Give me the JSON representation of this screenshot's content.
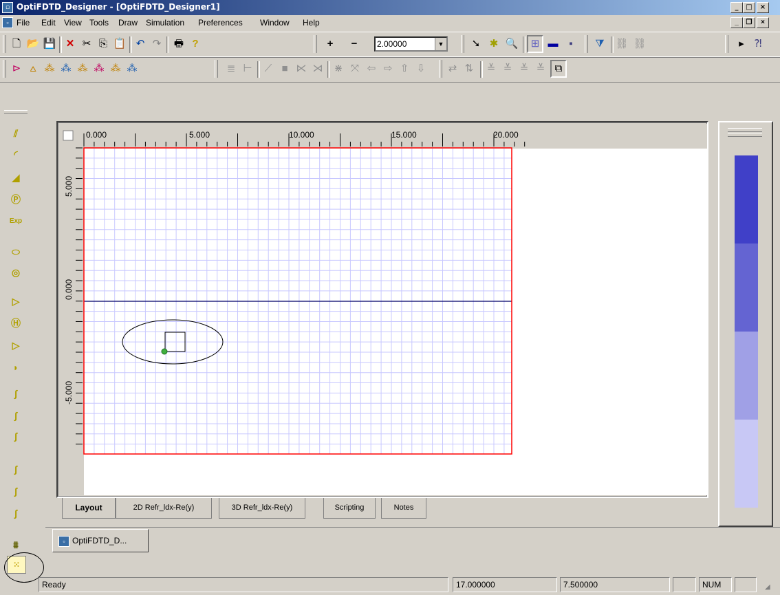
{
  "window": {
    "title": "OptiFDTD_Designer - [OptiFDTD_Designer1]",
    "app_icon": "optifdtd-app-icon"
  },
  "menu": [
    "File",
    "Edit",
    "View",
    "Tools",
    "Draw",
    "Simulation",
    "Preferences",
    "Window",
    "Help"
  ],
  "toolbar": {
    "zoom_value": "2.00000",
    "plus_label": "+",
    "minus_label": "−"
  },
  "ruler": {
    "h_labels": [
      "0.000",
      "5.000",
      "10.000",
      "15.000",
      "20.000"
    ],
    "v_labels": [
      "5.000",
      "0.000",
      "-5.000"
    ]
  },
  "tabs": [
    "Layout",
    "2D Refr_ldx-Re(y)",
    "3D Refr_ldx-Re(y)",
    "Scripting",
    "Notes"
  ],
  "doc_tab": {
    "label": "OptiFDTD_D..."
  },
  "status": {
    "text": "Ready",
    "x": "17.000000",
    "y": "7.500000",
    "num": "NUM"
  },
  "colors": {
    "title_start": "#0a246a",
    "grid": "#c8c8ff",
    "wafer_border": "#ff0000",
    "scale1": "#4040c8",
    "scale2": "#6464d2",
    "scale3": "#a0a0e6",
    "scale4": "#c8c8f5"
  }
}
